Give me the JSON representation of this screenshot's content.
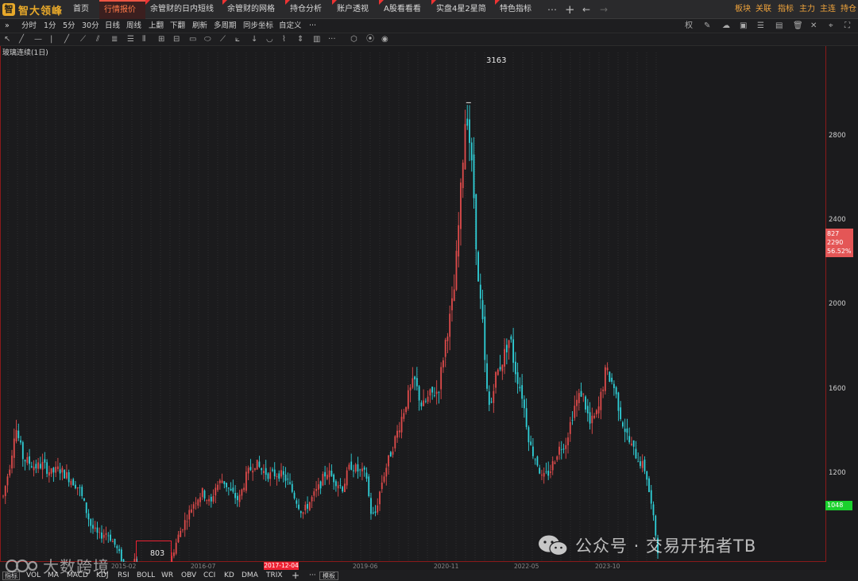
{
  "app": {
    "name": "智大领峰",
    "logo_glyph": "智"
  },
  "tabs": [
    {
      "label": "首页",
      "active": false
    },
    {
      "label": "行情报价",
      "active": true
    },
    {
      "label": "余管财的日内短线",
      "active": false
    },
    {
      "label": "余管财的网格",
      "active": false
    },
    {
      "label": "持仓分析",
      "active": false
    },
    {
      "label": "账户透视",
      "active": false
    },
    {
      "label": "A股看看看",
      "active": false
    },
    {
      "label": "实盘4星2星简",
      "active": false
    },
    {
      "label": "特色指标",
      "active": false
    }
  ],
  "tab_close": "×",
  "top_right_links": [
    "板块",
    "关联",
    "指标",
    "主力",
    "主连",
    "持仓"
  ],
  "periods": [
    "分时",
    "1分",
    "5分",
    "30分",
    "日线",
    "周线",
    "上翻",
    "下翻",
    "刷新",
    "多周期",
    "同步坐标",
    "自定义",
    "···"
  ],
  "toolbar_toggle": "»",
  "chart_title": "玻璃连续(1日)",
  "y_ticks": [
    "2800",
    "2400",
    "2000",
    "1600",
    "1200"
  ],
  "price_box": [
    "827",
    "2290",
    "56.52%"
  ],
  "last_price": "1048",
  "peak_label": "3163",
  "low_label": "803",
  "dates": [
    "2015-02",
    "2016-07",
    "2019-06",
    "2020-11",
    "2022-05",
    "2023-10"
  ],
  "cursor_date": "2017-12-04",
  "indicator_first": "指标",
  "indicators": [
    "VOL",
    "MA",
    "MACD",
    "KDJ",
    "RSI",
    "BOLL",
    "WR",
    "OBV",
    "CCI",
    "KD",
    "DMA",
    "TRIX",
    "+",
    "···"
  ],
  "template_button": "模板",
  "watermark_left": "大数跨境",
  "watermark_right": "公众号 · 交易开拓者TB",
  "colors": {
    "up": "#e04b4b",
    "down": "#2fd0d8",
    "accent": "#e8a92a"
  },
  "chart_data": {
    "type": "candlestick",
    "title": "玻璃连续(1日)",
    "ylim": [
      750,
      3300
    ],
    "y_ticks": [
      1200,
      1600,
      2000,
      2400,
      2800
    ],
    "annotations": [
      {
        "label": "3163",
        "value": 3163,
        "kind": "high"
      },
      {
        "label": "803",
        "value": 803,
        "kind": "low"
      }
    ],
    "last_price": 1048,
    "price_path": [
      [
        0,
        1300
      ],
      [
        2,
        1480
      ],
      [
        3,
        1640
      ],
      [
        5,
        1480
      ],
      [
        8,
        1440
      ],
      [
        10,
        1450
      ],
      [
        12,
        1410
      ],
      [
        14,
        1430
      ],
      [
        17,
        1380
      ],
      [
        19,
        1340
      ],
      [
        20,
        1280
      ],
      [
        22,
        1160
      ],
      [
        24,
        1110
      ],
      [
        26,
        1130
      ],
      [
        28,
        1070
      ],
      [
        30,
        990
      ],
      [
        31,
        920
      ],
      [
        32,
        960
      ],
      [
        33,
        1000
      ],
      [
        35,
        900
      ],
      [
        37,
        880
      ],
      [
        38,
        803
      ],
      [
        39,
        860
      ],
      [
        40,
        900
      ],
      [
        42,
        1000
      ],
      [
        44,
        1120
      ],
      [
        46,
        1200
      ],
      [
        48,
        1280
      ],
      [
        50,
        1320
      ],
      [
        52,
        1260
      ],
      [
        53,
        1340
      ],
      [
        55,
        1380
      ],
      [
        57,
        1320
      ],
      [
        59,
        1280
      ],
      [
        61,
        1400
      ],
      [
        63,
        1460
      ],
      [
        65,
        1420
      ],
      [
        67,
        1400
      ],
      [
        69,
        1410
      ],
      [
        71,
        1380
      ],
      [
        73,
        1300
      ],
      [
        75,
        1220
      ],
      [
        77,
        1280
      ],
      [
        79,
        1340
      ],
      [
        81,
        1420
      ],
      [
        83,
        1380
      ],
      [
        85,
        1340
      ],
      [
        87,
        1450
      ],
      [
        89,
        1420
      ],
      [
        91,
        1400
      ],
      [
        92,
        1230
      ],
      [
        93,
        1200
      ],
      [
        95,
        1380
      ],
      [
        97,
        1500
      ],
      [
        99,
        1620
      ],
      [
        101,
        1750
      ],
      [
        103,
        1850
      ],
      [
        105,
        1720
      ],
      [
        107,
        1780
      ],
      [
        109,
        1800
      ],
      [
        111,
        2060
      ],
      [
        112,
        2150
      ],
      [
        113,
        2280
      ],
      [
        114,
        2550
      ],
      [
        115,
        2850
      ],
      [
        116,
        3163
      ],
      [
        117,
        2950
      ],
      [
        118,
        2700
      ],
      [
        119,
        2300
      ],
      [
        120,
        2150
      ],
      [
        121,
        1820
      ],
      [
        122,
        1700
      ],
      [
        123,
        1850
      ],
      [
        125,
        1940
      ],
      [
        127,
        2060
      ],
      [
        128,
        1920
      ],
      [
        130,
        1780
      ],
      [
        132,
        1540
      ],
      [
        134,
        1450
      ],
      [
        135,
        1380
      ],
      [
        137,
        1420
      ],
      [
        139,
        1520
      ],
      [
        141,
        1560
      ],
      [
        143,
        1720
      ],
      [
        145,
        1800
      ],
      [
        147,
        1640
      ],
      [
        149,
        1700
      ],
      [
        151,
        1900
      ],
      [
        153,
        1820
      ],
      [
        155,
        1660
      ],
      [
        157,
        1550
      ],
      [
        159,
        1480
      ],
      [
        161,
        1420
      ],
      [
        163,
        1180
      ],
      [
        164,
        1048
      ]
    ]
  }
}
